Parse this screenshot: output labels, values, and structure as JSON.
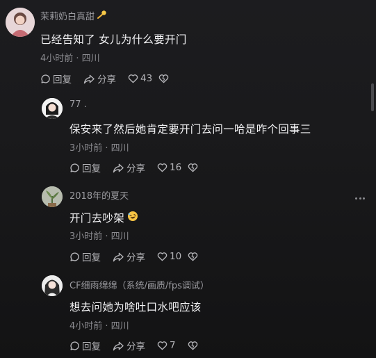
{
  "colors": {
    "background": "#18181b",
    "text_primary": "#f1f1f3",
    "text_secondary": "#9b9ba0",
    "action": "#b4b4b8"
  },
  "comments": [
    {
      "author": "茉莉奶白真甜",
      "author_badge_icon": "shooting-star-emoji",
      "text": "已经告知了 女儿为什么要开门",
      "time_location": "4小时前 · 四川",
      "reply_label": "回复",
      "share_label": "分享",
      "likes": "43"
    },
    {
      "author": "77 .",
      "text": "保安来了然后她肯定要开门去问一哈是咋个回事三",
      "time_location": "3小时前 · 四川",
      "reply_label": "回复",
      "share_label": "分享",
      "likes": "16"
    },
    {
      "author": "2018年的夏天",
      "text": "开门去吵架",
      "text_emoji_icon": "rolling-laughing-emoji",
      "time_location": "3小时前 · 四川",
      "reply_label": "回复",
      "share_label": "分享",
      "likes": "10"
    },
    {
      "author": "CF细雨绵绵（系统/画质/fps调试）",
      "text": "想去问她为啥吐口水吧应该",
      "time_location": "4小时前 · 四川",
      "reply_label": "回复",
      "share_label": "分享",
      "likes": "7"
    }
  ]
}
